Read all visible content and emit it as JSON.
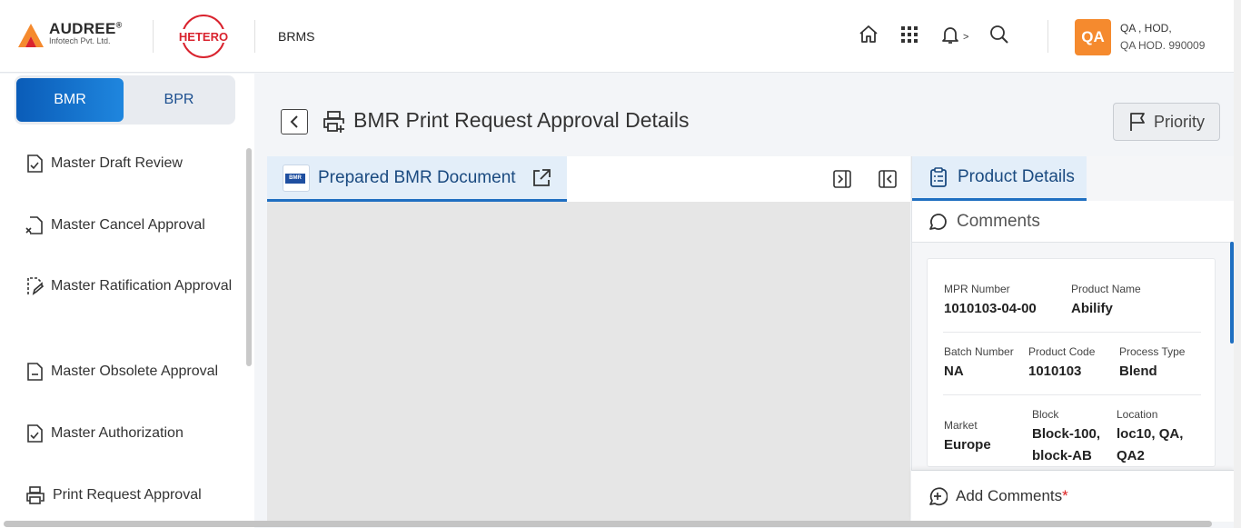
{
  "header": {
    "company_name": "AUDREE",
    "company_reg": "®",
    "company_sub": "Infotech Pvt. Ltd.",
    "partner_logo": "HETERO",
    "app_name": "BRMS",
    "icons": [
      "home-icon",
      "apps-grid-icon",
      "bell-icon",
      "search-icon"
    ],
    "notification_indicator": ">",
    "user": {
      "initials": "QA",
      "role": "QA , HOD,",
      "name_id": "QA HOD. 990009",
      "avatar_color": "#f58a2e"
    }
  },
  "sidebar": {
    "tabs": [
      {
        "label": "BMR",
        "active": true
      },
      {
        "label": "BPR",
        "active": false
      }
    ],
    "items": [
      {
        "label": "Master Draft Review",
        "icon": "doc-check-icon"
      },
      {
        "label": "Master Cancel Approval",
        "icon": "doc-cancel-icon"
      },
      {
        "label": "Master Ratification Approval",
        "icon": "doc-edit-icon"
      },
      {
        "label": "Master Obsolete Approval",
        "icon": "doc-minus-icon"
      },
      {
        "label": "Master Authorization",
        "icon": "doc-check-icon"
      },
      {
        "label": "Print Request Approval",
        "icon": "printer-icon"
      }
    ]
  },
  "main": {
    "title": "BMR Print Request Approval Details",
    "priority_label": "Priority",
    "document_tab": {
      "label": "Prepared BMR Document",
      "icon_text": "BMR"
    }
  },
  "right_panel": {
    "tabs": [
      {
        "label": "Product Details",
        "active": true
      },
      {
        "label": "Comments",
        "active": false
      }
    ],
    "details": {
      "mpr_number_label": "MPR Number",
      "mpr_number": "1010103-04-00",
      "product_name_label": "Product Name",
      "product_name": "Abilify",
      "batch_number_label": "Batch Number",
      "batch_number": "NA",
      "product_code_label": "Product Code",
      "product_code": "1010103",
      "process_type_label": "Process Type",
      "process_type": "Blend",
      "market_label": "Market",
      "market": "Europe",
      "block_label": "Block",
      "block_line1": "Block-100,",
      "block_line2": "block-AB",
      "location_label": "Location",
      "location_line1": "loc10, QA,",
      "location_line2": "QA2"
    },
    "add_comments": {
      "label": "Add Comments",
      "required_mark": "*"
    }
  },
  "colors": {
    "accent": "#1f6fc1",
    "active_tab_bg": "#e3eef9",
    "brand_orange": "#f58a2e",
    "hetero_red": "#d9232e"
  }
}
